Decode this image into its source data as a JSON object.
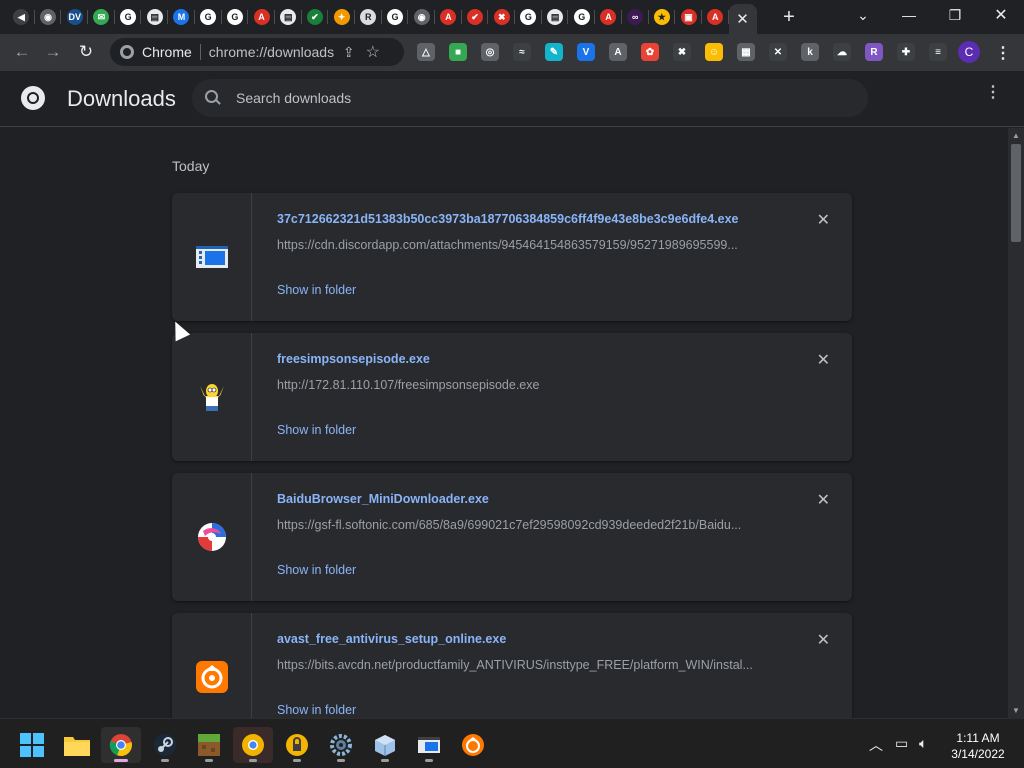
{
  "browser": {
    "tabs": [
      {
        "icon": "speaker-tab-icon",
        "color": "#3c4043",
        "glyph": "◀"
      },
      {
        "icon": "globe-tab-icon",
        "color": "#5f6368",
        "glyph": "◉"
      },
      {
        "icon": "dv-tab-icon",
        "color": "#1a4f8c",
        "glyph": "DV"
      },
      {
        "icon": "messages-tab-icon",
        "color": "#34a853",
        "glyph": "✉"
      },
      {
        "icon": "google-tab-icon",
        "color": "#ffffff",
        "glyph": "G"
      },
      {
        "icon": "chrome-store-tab-icon",
        "color": "#e8eaed",
        "glyph": "▤"
      },
      {
        "icon": "m-logo-tab-icon",
        "color": "#1a73e8",
        "glyph": "M"
      },
      {
        "icon": "google-tab-icon",
        "color": "#ffffff",
        "glyph": "G"
      },
      {
        "icon": "google-tab-icon",
        "color": "#ffffff",
        "glyph": "G"
      },
      {
        "icon": "ask-tab-icon",
        "color": "#d93025",
        "glyph": "A"
      },
      {
        "icon": "chrome-store-tab-icon",
        "color": "#e8eaed",
        "glyph": "▤"
      },
      {
        "icon": "check-tab-icon",
        "color": "#188038",
        "glyph": "✔"
      },
      {
        "icon": "puzzle-tab-icon",
        "color": "#f29900",
        "glyph": "✦"
      },
      {
        "icon": "r-tab-icon",
        "color": "#dadce0",
        "glyph": "R"
      },
      {
        "icon": "google-tab-icon",
        "color": "#ffffff",
        "glyph": "G"
      },
      {
        "icon": "globe-tab-icon",
        "color": "#5f6368",
        "glyph": "◉"
      },
      {
        "icon": "ask-tab-icon",
        "color": "#d93025",
        "glyph": "A"
      },
      {
        "icon": "check-red-tab-icon",
        "color": "#d93025",
        "glyph": "✔"
      },
      {
        "icon": "shield-tab-icon",
        "color": "#d93025",
        "glyph": "✖"
      },
      {
        "icon": "google-tab-icon",
        "color": "#ffffff",
        "glyph": "G"
      },
      {
        "icon": "chrome-store-tab-icon",
        "color": "#e8eaed",
        "glyph": "▤"
      },
      {
        "icon": "google-tab-icon",
        "color": "#ffffff",
        "glyph": "G"
      },
      {
        "icon": "ask-tab-icon",
        "color": "#d93025",
        "glyph": "A"
      },
      {
        "icon": "link-tab-icon",
        "color": "#3c1a52",
        "glyph": "∞"
      },
      {
        "icon": "yellow-tab-icon",
        "color": "#fbbc04",
        "glyph": "★"
      },
      {
        "icon": "gift-tab-icon",
        "color": "#d93025",
        "glyph": "▣"
      },
      {
        "icon": "ask-tab-icon",
        "color": "#d93025",
        "glyph": "A"
      }
    ],
    "active_tab_close": "✕",
    "new_tab": "+",
    "window_controls": {
      "tab_search": "⌄",
      "minimize": "—",
      "restore": "❐",
      "close": "✕"
    },
    "omnibox": {
      "site_label": "Chrome",
      "url": "chrome://downloads"
    },
    "extensions": [
      {
        "icon": "ext-triangle-icon",
        "color": "#5f6368",
        "glyph": "△"
      },
      {
        "icon": "ext-green-icon",
        "color": "#34a853",
        "glyph": "■"
      },
      {
        "icon": "ext-fingerprint-icon",
        "color": "#5f6368",
        "glyph": "◎"
      },
      {
        "icon": "ext-rss-icon",
        "color": "#3c4043",
        "glyph": "≈"
      },
      {
        "icon": "ext-feather-icon",
        "color": "#12b5cb",
        "glyph": "✎"
      },
      {
        "icon": "ext-vpn-shield-icon",
        "color": "#1a73e8",
        "glyph": "V"
      },
      {
        "icon": "ext-a-icon",
        "color": "#5f6368",
        "glyph": "A"
      },
      {
        "icon": "ext-colorful-icon",
        "color": "#ea4335",
        "glyph": "✿"
      },
      {
        "icon": "ext-tools-icon",
        "color": "#3c4043",
        "glyph": "✖"
      },
      {
        "icon": "ext-smiley-icon",
        "color": "#fbbc04",
        "glyph": "☺"
      },
      {
        "icon": "ext-terminal-icon",
        "color": "#5f6368",
        "glyph": "▦"
      },
      {
        "icon": "ext-cross-icon",
        "color": "#3c4043",
        "glyph": "✕"
      },
      {
        "icon": "ext-k-icon",
        "color": "#5f6368",
        "glyph": "k"
      },
      {
        "icon": "ext-cloud-icon",
        "color": "#3c4043",
        "glyph": "☁"
      },
      {
        "icon": "ext-r-icon",
        "color": "#7e57c2",
        "glyph": "R"
      },
      {
        "icon": "extensions-puzzle-icon",
        "color": "#3c4043",
        "glyph": "✚"
      },
      {
        "icon": "media-queue-icon",
        "color": "#3c4043",
        "glyph": "≡"
      }
    ],
    "profile_initial": "C"
  },
  "downloads": {
    "title": "Downloads",
    "search_placeholder": "Search downloads",
    "date_group": "Today",
    "items": [
      {
        "filename": "37c712662321d51383b50cc3973ba187706384859c6ff4f9e43e8be3c9e6dfe4.exe",
        "url": "https://cdn.discordapp.com/attachments/945464154863579159/95271989695599...",
        "action": "Show in folder",
        "icon": "window-app-file-icon"
      },
      {
        "filename": "freesimpsonsepisode.exe",
        "url": "http://172.81.110.107/freesimpsonsepisode.exe",
        "action": "Show in folder",
        "icon": "homer-simpson-file-icon"
      },
      {
        "filename": "BaiduBrowser_MiniDownloader.exe",
        "url": "https://gsf-fl.softonic.com/685/8a9/699021c7ef29598092cd939deeded2f21b/Baidu...",
        "action": "Show in folder",
        "icon": "baidu-browser-file-icon"
      },
      {
        "filename": "avast_free_antivirus_setup_online.exe",
        "url": "https://bits.avcdn.net/productfamily_ANTIVIRUS/insttype_FREE/platform_WIN/instal...",
        "action": "Show in folder",
        "icon": "avast-file-icon"
      }
    ]
  },
  "taskbar": {
    "apps": [
      {
        "name": "start-button",
        "icon": "windows-start-icon",
        "active": false,
        "running": false
      },
      {
        "name": "taskbar-file-explorer",
        "icon": "folder-icon",
        "active": false,
        "running": false
      },
      {
        "name": "taskbar-chrome",
        "icon": "chrome-icon",
        "active": true,
        "running": true
      },
      {
        "name": "taskbar-steam",
        "icon": "steam-icon",
        "active": false,
        "running": true
      },
      {
        "name": "taskbar-minecraft",
        "icon": "minecraft-icon",
        "active": false,
        "running": true
      },
      {
        "name": "taskbar-chrome-canary",
        "icon": "chrome-yellow-icon",
        "active": false,
        "running": true
      },
      {
        "name": "taskbar-keepass",
        "icon": "lock-app-icon",
        "active": false,
        "running": true
      },
      {
        "name": "taskbar-settings",
        "icon": "gear-icon",
        "active": false,
        "running": true
      },
      {
        "name": "taskbar-package-app",
        "icon": "box-icon",
        "active": false,
        "running": true
      },
      {
        "name": "taskbar-window-app",
        "icon": "window-app-icon",
        "active": false,
        "running": true
      },
      {
        "name": "taskbar-avast",
        "icon": "avast-icon",
        "active": false,
        "running": false
      }
    ],
    "time": "1:11 AM",
    "date": "3/14/2022"
  }
}
